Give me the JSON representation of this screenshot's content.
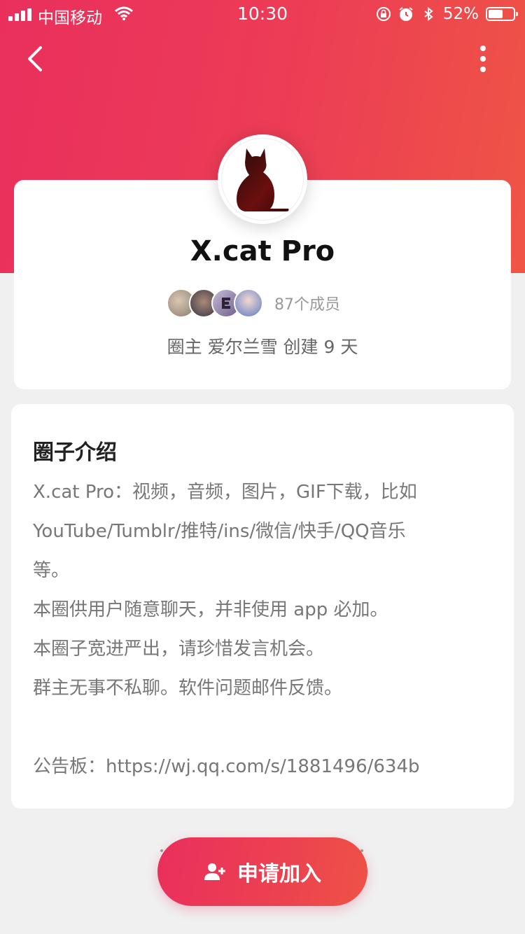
{
  "status_bar": {
    "carrier": "中国移动",
    "time": "10:30",
    "battery_percent": "52%"
  },
  "nav": {
    "back_icon": "chevron-left-icon",
    "more_icon": "more-vertical-icon"
  },
  "circle": {
    "name": "X.cat Pro",
    "member_count": "87个成员",
    "owner_line": "圈主 爱尔兰雪 创建 9 天"
  },
  "intro": {
    "title": "圈子介绍",
    "lines": [
      "X.cat Pro：视频，音频，图片，GIF下载，比如",
      "YouTube/Tumblr/推特/ins/微信/快手/QQ音乐",
      "等。",
      "本圈供用户随意聊天，并非使用 app 必加。",
      "本圈子宽进严出，请珍惜发言机会。",
      "群主无事不私聊。软件问题邮件反馈。",
      "",
      "公告板：https://wj.qq.com/s/1881496/634b"
    ]
  },
  "join_button": {
    "label": "申请加入",
    "icon": "add-user-icon"
  },
  "colors": {
    "accent_start": "#ea2f5d",
    "accent_end": "#ef5545"
  }
}
